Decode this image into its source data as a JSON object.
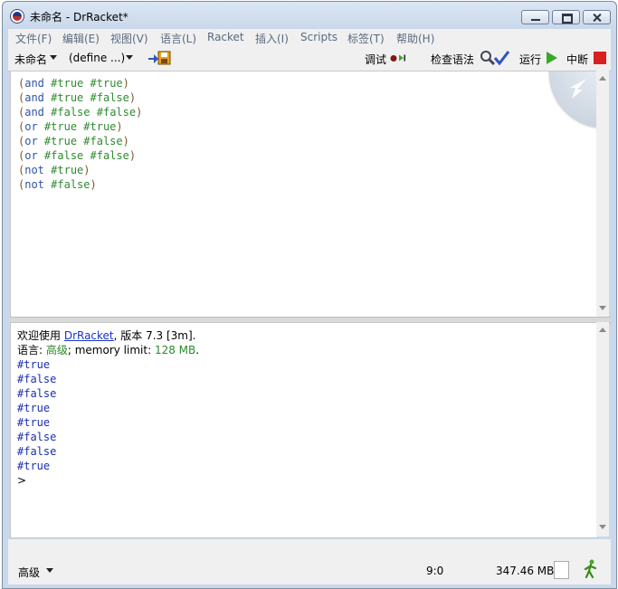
{
  "window": {
    "title": "未命名 - DrRacket*"
  },
  "menu": {
    "items": [
      {
        "label": "文件(F)"
      },
      {
        "label": "编辑(E)"
      },
      {
        "label": "视图(V)"
      },
      {
        "label": "语言(L)"
      },
      {
        "label": "Racket"
      },
      {
        "label": "插入(I)"
      },
      {
        "label": "Scripts"
      },
      {
        "label": "标签(T)"
      },
      {
        "label": "帮助(H)"
      }
    ]
  },
  "toolbar": {
    "filename": "未命名",
    "define_menu": "(define ...)",
    "debug_label": "调试",
    "check_syntax_label": "检查语法",
    "run_label": "运行",
    "stop_label": "中断"
  },
  "editor": {
    "lines": [
      {
        "op": "and",
        "a": "#true",
        "b": "#true"
      },
      {
        "op": "and",
        "a": "#true",
        "b": "#false"
      },
      {
        "op": "and",
        "a": "#false",
        "b": "#false"
      },
      {
        "op": "or",
        "a": "#true",
        "b": "#true"
      },
      {
        "op": "or",
        "a": "#true",
        "b": "#false"
      },
      {
        "op": "or",
        "a": "#false",
        "b": "#false"
      },
      {
        "op": "not",
        "a": "#true",
        "b": ""
      },
      {
        "op": "not",
        "a": "#false",
        "b": ""
      }
    ]
  },
  "repl": {
    "welcome_prefix": "欢迎使用 ",
    "welcome_link": "DrRacket",
    "welcome_suffix": ", 版本 7.3 [3m].",
    "language_prefix": "语言: ",
    "language_name": "高级",
    "language_mid": "; memory limit: ",
    "memory_limit": "128 MB",
    "language_end": ".",
    "results": [
      "#true",
      "#false",
      "#false",
      "#true",
      "#true",
      "#false",
      "#false",
      "#true"
    ],
    "prompt": ">"
  },
  "status": {
    "language": "高级",
    "position": "9:0",
    "memory": "347.46 MB"
  },
  "colors": {
    "keyword": "#2e54a8",
    "constant": "#2f8b2f",
    "paren": "#7a5a2a",
    "output": "#1a2fb0"
  }
}
